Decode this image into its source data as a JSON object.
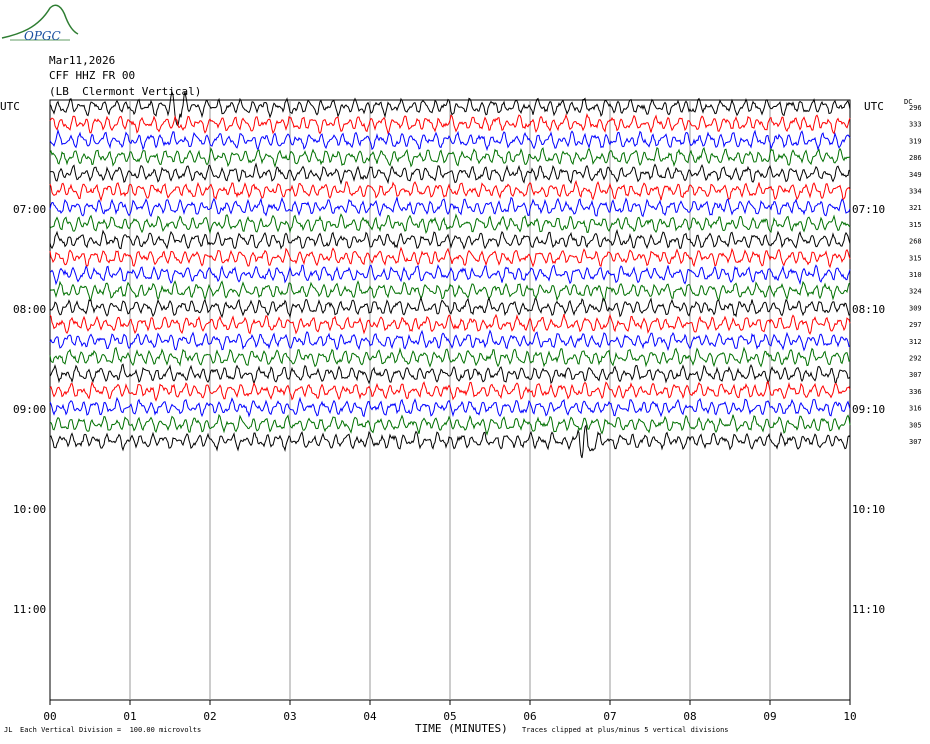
{
  "logo": {
    "text": "OPGC",
    "icon": "opgc-logo"
  },
  "header": {
    "date": "Mar11,2026",
    "station": "CFF HHZ FR 00",
    "location": "(LB  Clermont Vertical)"
  },
  "timezone_left": "UTC",
  "timezone_right": "UTC",
  "dc_label": "DC",
  "left_time_labels": [
    "07:00",
    "08:00",
    "09:00",
    "10:00",
    "11:00"
  ],
  "right_time_labels": [
    "07:10",
    "08:10",
    "09:10",
    "10:10",
    "11:10"
  ],
  "footer": {
    "scale_note": "Each Vertical Division =  100.00 microvolts",
    "x_title": "TIME (MINUTES)",
    "clip_note": "Traces clipped at plus/minus 5 vertical divisions",
    "corner_mark": "JL"
  },
  "colors": {
    "trace_cycle": [
      "#000000",
      "#ff0000",
      "#0000ff",
      "#007000"
    ],
    "grid": "#999999",
    "logo": "#2e7d32",
    "logo_text": "#1a4fa0"
  },
  "chart_data": {
    "type": "line",
    "title": "Mar11,2026",
    "xlabel": "TIME (MINUTES)",
    "x_ticks": [
      "00",
      "01",
      "02",
      "03",
      "04",
      "05",
      "06",
      "07",
      "08",
      "09",
      "10"
    ],
    "xlim": [
      0,
      10
    ],
    "trace_count": 21,
    "dc_offsets": [
      296,
      333,
      319,
      286,
      349,
      334,
      321,
      315,
      268,
      315,
      310,
      324,
      309,
      297,
      312,
      292,
      307,
      336,
      316,
      305,
      307
    ],
    "events": [
      {
        "trace": 0,
        "minute": 1.6,
        "note": "spike"
      },
      {
        "trace": 20,
        "minute": 6.7,
        "note": "burst"
      }
    ]
  }
}
